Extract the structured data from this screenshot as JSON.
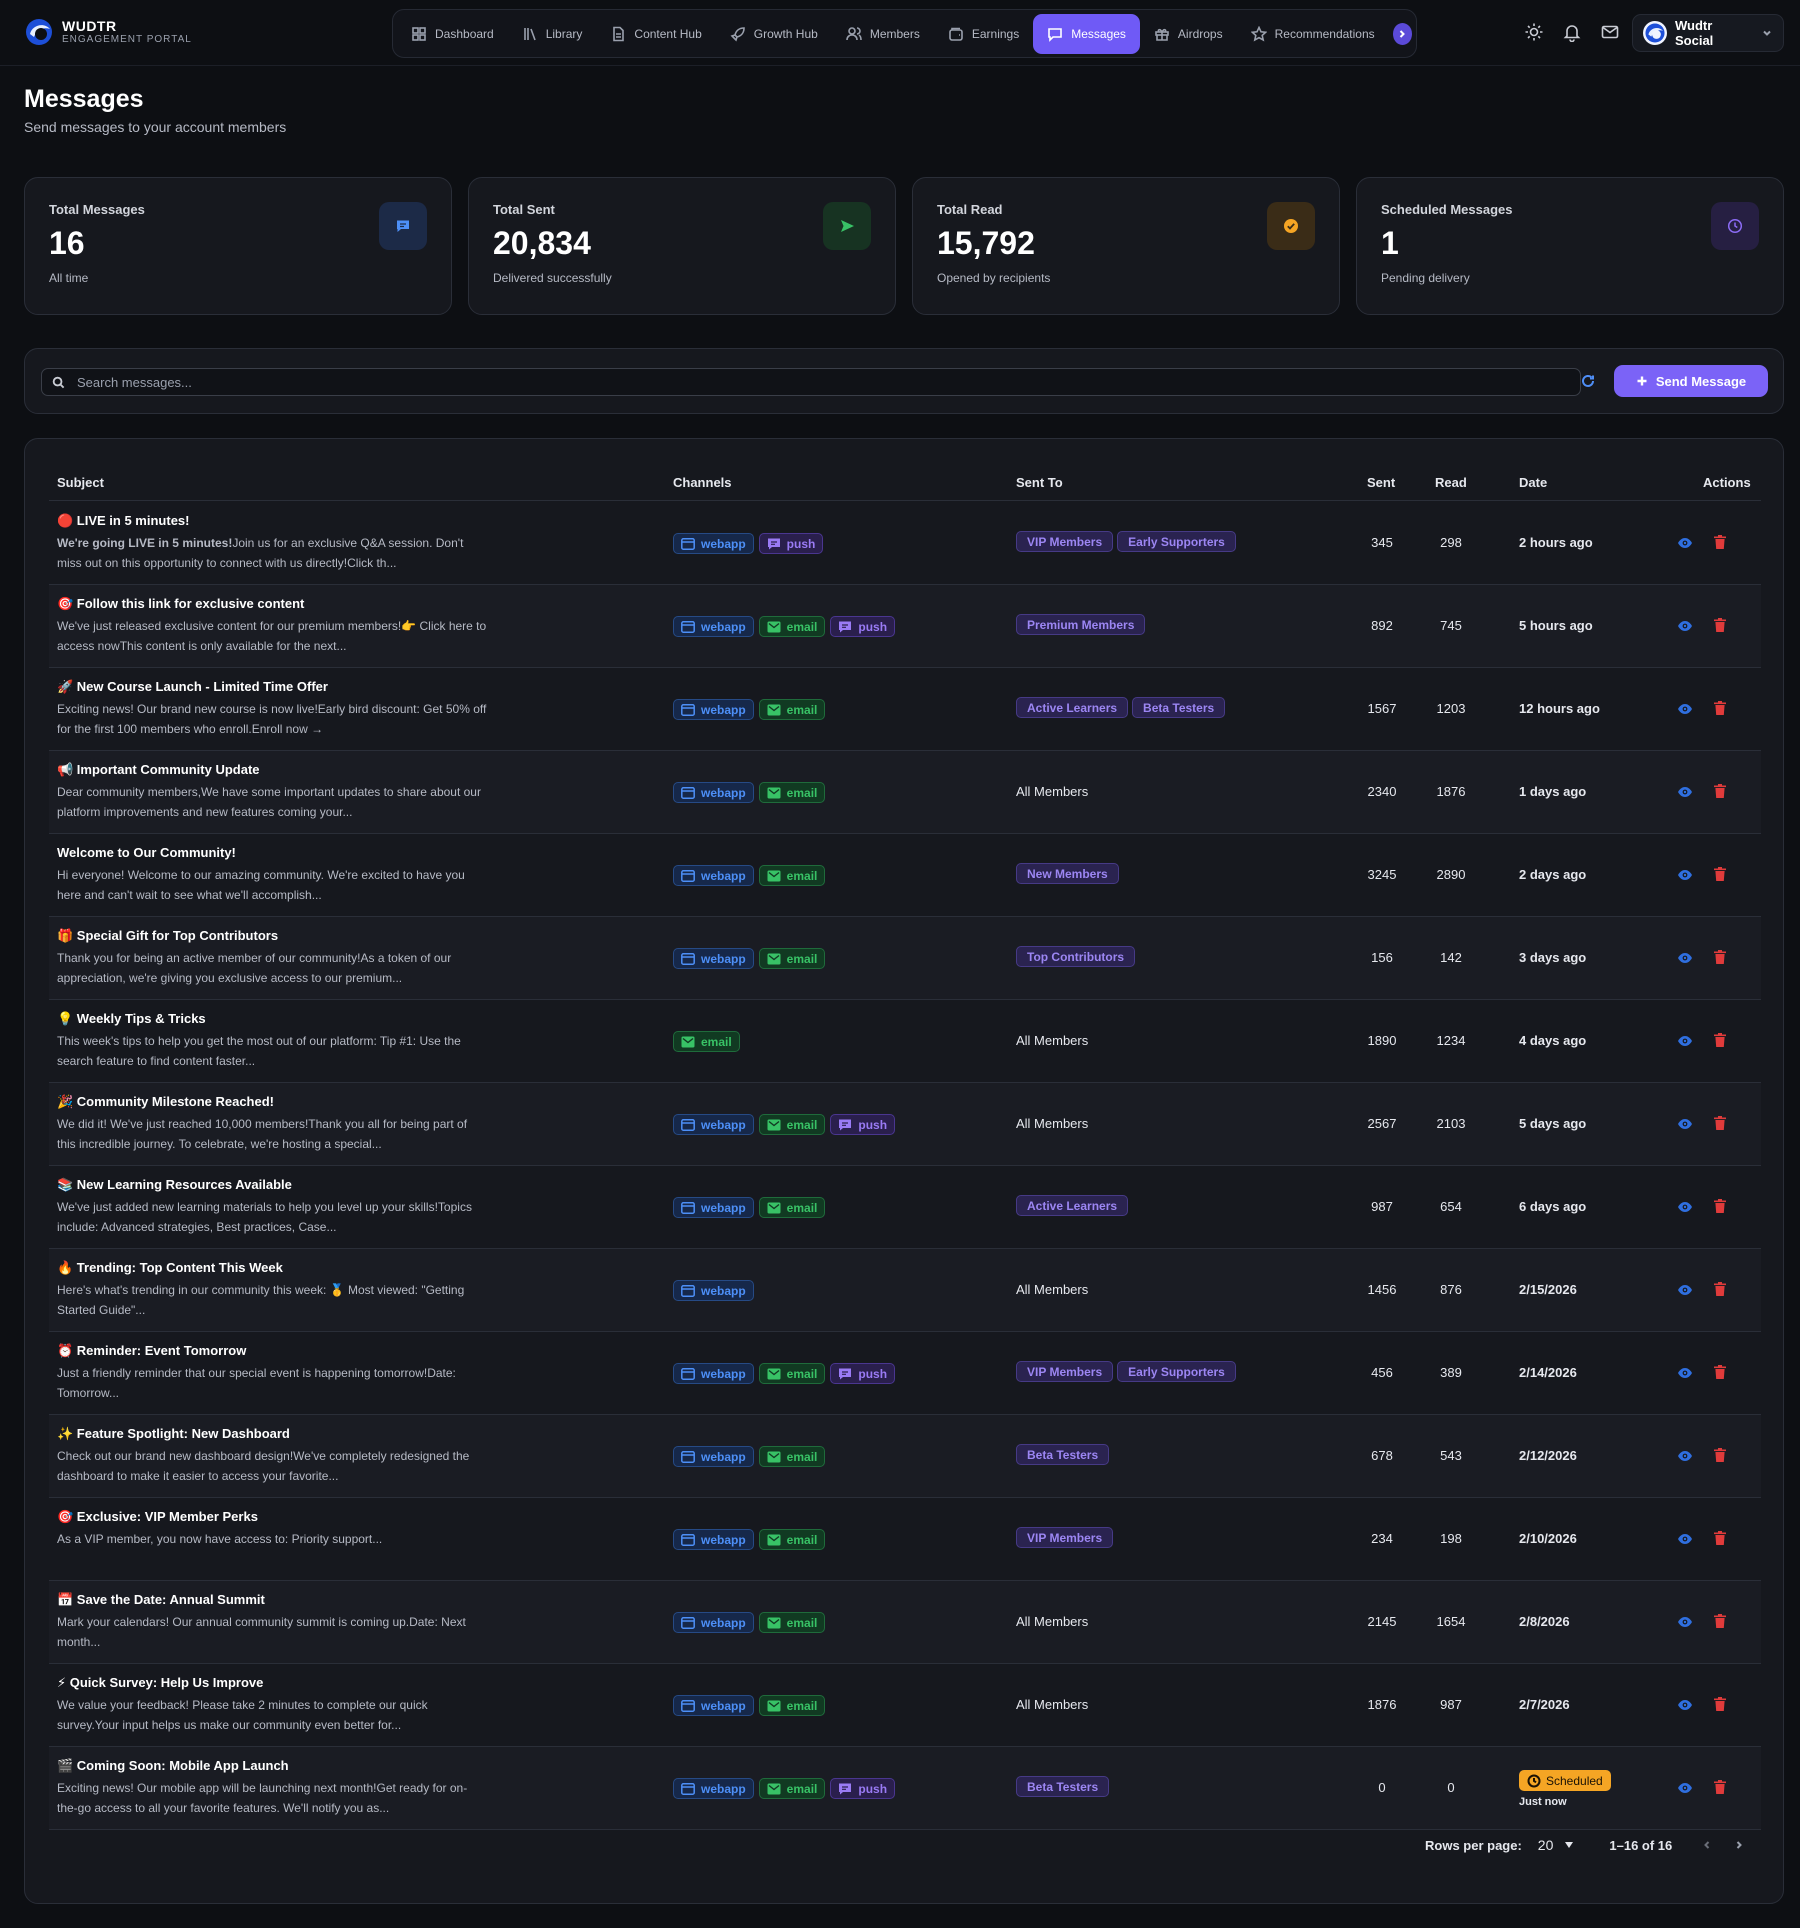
{
  "brand": {
    "name": "WUDTR",
    "sub": "ENGAGEMENT PORTAL"
  },
  "nav": [
    {
      "label": "Dashboard",
      "icon": "grid-icon"
    },
    {
      "label": "Library",
      "icon": "library-icon"
    },
    {
      "label": "Content Hub",
      "icon": "document-icon"
    },
    {
      "label": "Growth Hub",
      "icon": "rocket-icon"
    },
    {
      "label": "Members",
      "icon": "users-icon"
    },
    {
      "label": "Earnings",
      "icon": "wallet-icon"
    },
    {
      "label": "Messages",
      "icon": "chat-icon",
      "active": true
    },
    {
      "label": "Airdrops",
      "icon": "gift-icon"
    },
    {
      "label": "Recommendations",
      "icon": "star-icon"
    }
  ],
  "account": {
    "name": "Wudtr Social"
  },
  "page": {
    "title": "Messages",
    "subtitle": "Send messages to your account members"
  },
  "stats": [
    {
      "label": "Total Messages",
      "value": "16",
      "note": "All time",
      "icon": "message-icon",
      "color": "#4d8ff7",
      "bg": "#1c2a47"
    },
    {
      "label": "Total Sent",
      "value": "20,834",
      "note": "Delivered successfully",
      "icon": "send-icon",
      "color": "#38c266",
      "bg": "#173322"
    },
    {
      "label": "Total Read",
      "value": "15,792",
      "note": "Opened by recipients",
      "icon": "check-circle-icon",
      "color": "#f5a524",
      "bg": "#3a2c17"
    },
    {
      "label": "Scheduled Messages",
      "value": "1",
      "note": "Pending delivery",
      "icon": "clock-icon",
      "color": "#8c6cf5",
      "bg": "#261f42"
    }
  ],
  "search": {
    "placeholder": "Search messages..."
  },
  "send_button": "Send Message",
  "table": {
    "columns": {
      "subject": "Subject",
      "channels": "Channels",
      "sent_to": "Sent To",
      "sent": "Sent",
      "read": "Read",
      "date": "Date",
      "actions": "Actions"
    },
    "rows": [
      {
        "title": "🔴 LIVE in 5 minutes!",
        "preview_bold": "We're going LIVE in 5 minutes!",
        "preview": "Join us for an exclusive Q&A session. Don't miss out on this opportunity to connect with us directly!Click th...",
        "channels": [
          "webapp",
          "push"
        ],
        "groups": [
          "VIP Members",
          "Early Supporters"
        ],
        "sent": "345",
        "read": "298",
        "date": "2 hours ago"
      },
      {
        "title": "🎯 Follow this link for exclusive content",
        "preview_bold": "",
        "preview": "We've just released exclusive content for our premium members!👉 Click here to access nowThis content is only available for the next...",
        "channels": [
          "webapp",
          "email",
          "push"
        ],
        "groups": [
          "Premium Members"
        ],
        "sent": "892",
        "read": "745",
        "date": "5 hours ago"
      },
      {
        "title": "🚀 New Course Launch - Limited Time Offer",
        "preview_bold": "",
        "preview": "Exciting news! Our brand new course is now live!Early bird discount: Get 50% off for the first 100 members who enroll.Enroll now →",
        "channels": [
          "webapp",
          "email"
        ],
        "groups": [
          "Active Learners",
          "Beta Testers"
        ],
        "sent": "1567",
        "read": "1203",
        "date": "12 hours ago"
      },
      {
        "title": "📢 Important Community Update",
        "preview_bold": "",
        "preview": "Dear community members,We have some important updates to share about our platform improvements and new features coming your...",
        "channels": [
          "webapp",
          "email"
        ],
        "groups": [],
        "all": "All Members",
        "sent": "2340",
        "read": "1876",
        "date": "1 days ago"
      },
      {
        "title": "Welcome to Our Community!",
        "preview_bold": "",
        "preview": "Hi everyone! Welcome to our amazing community. We're excited to have you here and can't wait to see what we'll accomplish...",
        "channels": [
          "webapp",
          "email"
        ],
        "groups": [
          "New Members"
        ],
        "sent": "3245",
        "read": "2890",
        "date": "2 days ago"
      },
      {
        "title": "🎁 Special Gift for Top Contributors",
        "preview_bold": "",
        "preview": "Thank you for being an active member of our community!As a token of our appreciation, we're giving you exclusive access to our premium...",
        "channels": [
          "webapp",
          "email"
        ],
        "groups": [
          "Top Contributors"
        ],
        "sent": "156",
        "read": "142",
        "date": "3 days ago"
      },
      {
        "title": "💡 Weekly Tips & Tricks",
        "preview_bold": "",
        "preview": "This week's tips to help you get the most out of our platform: Tip #1: Use the search feature to find content faster...",
        "channels": [
          "email"
        ],
        "groups": [],
        "all": "All Members",
        "sent": "1890",
        "read": "1234",
        "date": "4 days ago"
      },
      {
        "title": "🎉 Community Milestone Reached!",
        "preview_bold": "",
        "preview": "We did it! We've just reached 10,000 members!Thank you all for being part of this incredible journey. To celebrate, we're hosting a special...",
        "channels": [
          "webapp",
          "email",
          "push"
        ],
        "groups": [],
        "all": "All Members",
        "sent": "2567",
        "read": "2103",
        "date": "5 days ago"
      },
      {
        "title": "📚 New Learning Resources Available",
        "preview_bold": "",
        "preview": "We've just added new learning materials to help you level up your skills!Topics include: Advanced strategies, Best practices, Case...",
        "channels": [
          "webapp",
          "email"
        ],
        "groups": [
          "Active Learners"
        ],
        "sent": "987",
        "read": "654",
        "date": "6 days ago"
      },
      {
        "title": "🔥 Trending: Top Content This Week",
        "preview_bold": "",
        "preview": "Here's what's trending in our community this week: 🥇 Most viewed: \"Getting Started Guide\"...",
        "channels": [
          "webapp"
        ],
        "groups": [],
        "all": "All Members",
        "sent": "1456",
        "read": "876",
        "date": "2/15/2026"
      },
      {
        "title": "⏰ Reminder: Event Tomorrow",
        "preview_bold": "",
        "preview": "Just a friendly reminder that our special event is happening tomorrow!Date: Tomorrow...",
        "channels": [
          "webapp",
          "email",
          "push"
        ],
        "groups": [
          "VIP Members",
          "Early Supporters"
        ],
        "sent": "456",
        "read": "389",
        "date": "2/14/2026"
      },
      {
        "title": "✨ Feature Spotlight: New Dashboard",
        "preview_bold": "",
        "preview": "Check out our brand new dashboard design!We've completely redesigned the dashboard to make it easier to access your favorite...",
        "channels": [
          "webapp",
          "email"
        ],
        "groups": [
          "Beta Testers"
        ],
        "sent": "678",
        "read": "543",
        "date": "2/12/2026"
      },
      {
        "title": "🎯 Exclusive: VIP Member Perks",
        "preview_bold": "",
        "preview": "As a VIP member, you now have access to: Priority support...",
        "channels": [
          "webapp",
          "email"
        ],
        "groups": [
          "VIP Members"
        ],
        "sent": "234",
        "read": "198",
        "date": "2/10/2026"
      },
      {
        "title": "📅 Save the Date: Annual Summit",
        "preview_bold": "",
        "preview": "Mark your calendars! Our annual community summit is coming up.Date: Next month...",
        "channels": [
          "webapp",
          "email"
        ],
        "groups": [],
        "all": "All Members",
        "sent": "2145",
        "read": "1654",
        "date": "2/8/2026"
      },
      {
        "title": "⚡ Quick Survey: Help Us Improve",
        "preview_bold": "",
        "preview": "We value your feedback! Please take 2 minutes to complete our quick survey.Your input helps us make our community even better for...",
        "channels": [
          "webapp",
          "email"
        ],
        "groups": [],
        "all": "All Members",
        "sent": "1876",
        "read": "987",
        "date": "2/7/2026"
      },
      {
        "title": "🎬 Coming Soon: Mobile App Launch",
        "preview_bold": "",
        "preview": "Exciting news! Our mobile app will be launching next month!Get ready for on-the-go access to all your favorite features. We'll notify you as...",
        "channels": [
          "webapp",
          "email",
          "push"
        ],
        "groups": [
          "Beta Testers"
        ],
        "sent": "0",
        "read": "0",
        "scheduled": "Scheduled",
        "date": "Just now"
      }
    ]
  },
  "pagination": {
    "rows_label": "Rows per page:",
    "rows_value": "20",
    "range": "1–16 of 16"
  }
}
